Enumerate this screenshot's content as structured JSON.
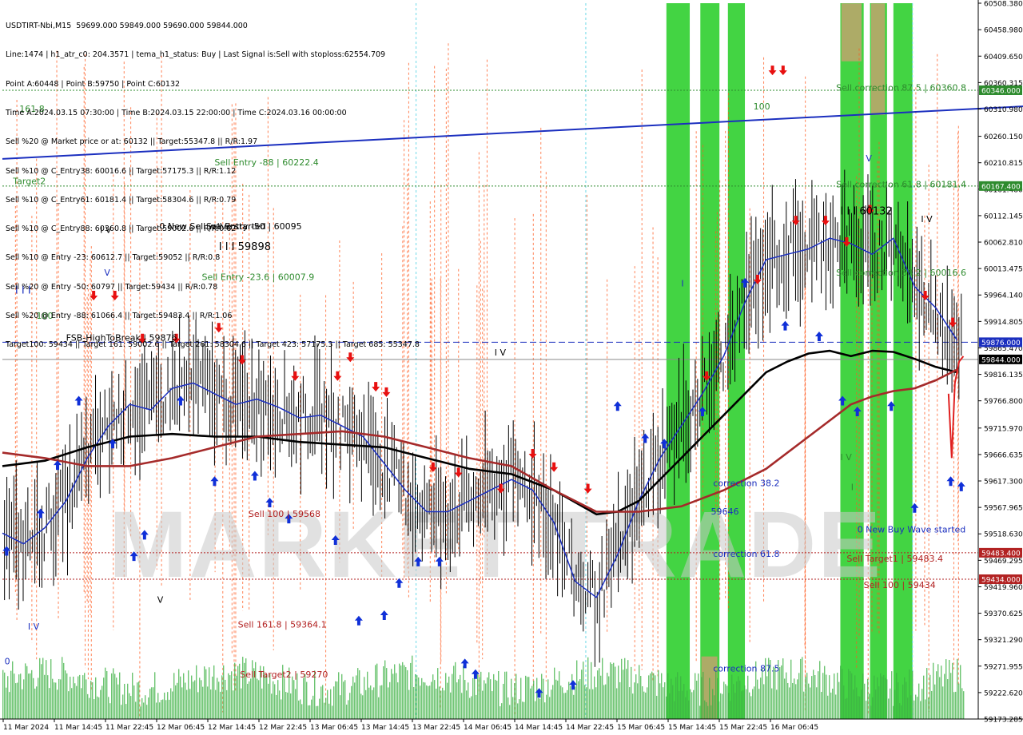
{
  "header": {
    "lines": [
      "USDTIRT-Nbi,M15  59699.000 59849.000 59690.000 59844.000",
      "Line:1474 | h1_atr_c0: 204.3571 | tema_h1_status: Buy | Last Signal is:Sell with stoploss:62554.709",
      "Point A:60448 | Point B:59750 | Point C:60132",
      "Time A:2024.03.15 07:30:00 | Time B:2024.03.15 22:00:00 | Time C:2024.03.16 00:00:00",
      "Sell %20 @ Market price or at: 60132 || Target:55347.8 || R/R:1.97",
      "Sell %10 @ C_Entry38: 60016.6 || Target:57175.3 || R/R:1.12",
      "Sell %10 @ C_Entry61: 60181.4 || Target:58304.6 || R/R:0.79",
      "Sell %10 @ C_Entry88: 60360.8 || Target:59002.6 || R/R:0.62",
      "Sell %10 @ Entry -23: 60612.7 || Target:59052 || R/R:0.8",
      "Sell %20 @ Entry -50: 60797 || Target:59434 || R/R:0.78",
      "Sell %20 @ Entry -88: 61066.4 || Target:59483.4 || R/R:1.06",
      "Target100: 59434 || Target 161: 59002.6 || Target 261: 58304.6 || Target 423: 57175.3 || Target 685: 55347.8"
    ]
  },
  "watermark": "MARKET TRADE",
  "chart_data": {
    "type": "candlestick",
    "symbol": "USDTIRT-Nbi",
    "timeframe": "M15",
    "ylim": [
      59173.285,
      60508.38
    ],
    "y_ticks": [
      "60508.380",
      "60458.980",
      "60409.650",
      "60360.315",
      "60310.980",
      "60260.150",
      "60210.815",
      "60161.480",
      "60112.145",
      "60062.810",
      "60013.475",
      "59964.140",
      "59914.805",
      "59865.470",
      "59816.135",
      "59766.800",
      "59715.970",
      "59666.635",
      "59617.300",
      "59567.965",
      "59518.630",
      "59469.295",
      "59419.960",
      "59370.625",
      "59321.290",
      "59271.955",
      "59222.620",
      "59173.285"
    ],
    "x_labels": [
      "11 Mar 2024",
      "11 Mar 14:45",
      "11 Mar 22:45",
      "12 Mar 06:45",
      "12 Mar 14:45",
      "12 Mar 22:45",
      "13 Mar 06:45",
      "13 Mar 14:45",
      "13 Mar 22:45",
      "14 Mar 06:45",
      "14 Mar 14:45",
      "14 Mar 22:45",
      "15 Mar 06:45",
      "15 Mar 14:45",
      "15 Mar 22:45",
      "16 Mar 06:45"
    ],
    "price_tags": [
      {
        "value": 60346.0,
        "label": "60346.000",
        "color": "#2e8b2e"
      },
      {
        "value": 60167.4,
        "label": "60167.400",
        "color": "#2e8b2e"
      },
      {
        "value": 59876.0,
        "label": "59876.000",
        "color": "#1b2fbf"
      },
      {
        "value": 59844.0,
        "label": "59844.000",
        "color": "#000000"
      },
      {
        "value": 59483.4,
        "label": "59483.400",
        "color": "#b22222"
      },
      {
        "value": 59434.0,
        "label": "59434.000",
        "color": "#b22222"
      }
    ],
    "levels": [
      {
        "value": 60346.0,
        "color": "#2e8b2e",
        "style": "dotted"
      },
      {
        "value": 60167.4,
        "color": "#2e8b2e",
        "style": "dotted"
      },
      {
        "value": 59876.0,
        "color": "#1b2fbf",
        "style": "dashed"
      },
      {
        "value": 59844.0,
        "color": "#8a8a8a",
        "style": "solid"
      },
      {
        "value": 59483.4,
        "color": "#b22222",
        "style": "dotted"
      },
      {
        "value": 59434.0,
        "color": "#b22222",
        "style": "dotted"
      }
    ],
    "annotations": [
      {
        "text": "161.8",
        "color": "#2e8b2e",
        "at": [
          0.8,
          60306
        ]
      },
      {
        "text": "Target2",
        "color": "#2e8b2e",
        "at": [
          0.5,
          60171
        ]
      },
      {
        "text": "100",
        "color": "#2e8b2e",
        "at": [
          1.6,
          59920
        ]
      },
      {
        "text": "Sell Entry -88 | 60222.4",
        "color": "#2e8b2e",
        "at": [
          10,
          60206
        ]
      },
      {
        "text": "0 New Sell wave started",
        "color": "#000000",
        "at": [
          7.4,
          60087
        ]
      },
      {
        "text": "Sell Entry -50 | 60095",
        "color": "#000000",
        "at": [
          9.6,
          60087
        ]
      },
      {
        "text": "I I I 59898",
        "color": "#000000",
        "at": [
          10.2,
          60048
        ]
      },
      {
        "text": "Sell Entry -23.6 | 60007.9",
        "color": "#2e8b2e",
        "at": [
          9.4,
          59992
        ]
      },
      {
        "text": "I V",
        "color": "#000000",
        "at": [
          4.6,
          60080
        ]
      },
      {
        "text": "V",
        "color": "#1b2fbf",
        "at": [
          4.8,
          60000
        ]
      },
      {
        "text": "I I I",
        "color": "#1b2fbf",
        "at": [
          0.6,
          59967
        ]
      },
      {
        "text": "FSB-HighToBreak | 59876",
        "color": "#000000",
        "at": [
          3,
          59879
        ]
      },
      {
        "text": "I V",
        "color": "#000000",
        "at": [
          23.2,
          59851
        ]
      },
      {
        "text": "Sell 100 | 59568",
        "color": "#b22222",
        "at": [
          11.6,
          59550
        ]
      },
      {
        "text": "Sell 161.8 | 59364.1",
        "color": "#b22222",
        "at": [
          11.1,
          59344
        ]
      },
      {
        "text": "Sell Target2 | 59270",
        "color": "#b22222",
        "at": [
          11.2,
          59251
        ]
      },
      {
        "text": "V",
        "color": "#000000",
        "at": [
          7.3,
          59390
        ]
      },
      {
        "text": "I V",
        "color": "#1b2fbf",
        "at": [
          1.2,
          59340
        ]
      },
      {
        "text": "0",
        "color": "#1b2fbf",
        "at": [
          0.1,
          59275
        ]
      },
      {
        "text": "I",
        "color": "#1b2fbf",
        "at": [
          32,
          59980
        ]
      },
      {
        "text": "100",
        "color": "#2e8b2e",
        "at": [
          35.4,
          60310
        ]
      },
      {
        "text": "Sell correction 87.5 | 60360.8",
        "color": "#2e8b2e",
        "at": [
          39.3,
          60345
        ]
      },
      {
        "text": "I I I 60132",
        "color": "#000000",
        "at": [
          39.5,
          60114
        ]
      },
      {
        "text": "V",
        "color": "#1b2fbf",
        "at": [
          40.7,
          60213
        ]
      },
      {
        "text": "Sell correction 61.8 | 60181.4",
        "color": "#2e8b2e",
        "at": [
          39.3,
          60165
        ]
      },
      {
        "text": "I V",
        "color": "#000000",
        "at": [
          43.3,
          60100
        ]
      },
      {
        "text": "Sell correction 38.2 | 60016.6",
        "color": "#2e8b2e",
        "at": [
          39.3,
          60000
        ]
      },
      {
        "text": "correction 38.2",
        "color": "#1b2fbf",
        "at": [
          33.5,
          59608
        ]
      },
      {
        "text": "59646",
        "color": "#1b2fbf",
        "at": [
          33.4,
          59555
        ]
      },
      {
        "text": "correction 61.8",
        "color": "#1b2fbf",
        "at": [
          33.5,
          59476
        ]
      },
      {
        "text": "correction 87.5",
        "color": "#1b2fbf",
        "at": [
          33.5,
          59262
        ]
      },
      {
        "text": "I V",
        "color": "#2e8b2e",
        "at": [
          39.5,
          59656
        ]
      },
      {
        "text": "I",
        "color": "#2e8b2e",
        "at": [
          40,
          59600
        ]
      },
      {
        "text": "0 New Buy Wave started",
        "color": "#1b2fbf",
        "at": [
          40.3,
          59521
        ]
      },
      {
        "text": "Sell Target1 | 59483.4",
        "color": "#b22222",
        "at": [
          39.8,
          59467
        ]
      },
      {
        "text": "Sell 100 | 59434",
        "color": "#b22222",
        "at": [
          40.6,
          59418
        ]
      }
    ],
    "trendline": {
      "color": "#1b2fbf",
      "from": [
        0,
        60218
      ],
      "to": [
        55,
        60330
      ]
    },
    "green_zones": [
      [
        31.3,
        32.4
      ],
      [
        32.9,
        33.8
      ],
      [
        34.2,
        35.0
      ],
      [
        39.5,
        40.6
      ],
      [
        40.9,
        41.7
      ],
      [
        42.0,
        42.9
      ]
    ],
    "series": [
      {
        "name": "",
        "color": "#1b2fbf",
        "style": "line",
        "x": [
          0,
          1,
          2,
          3,
          4,
          5,
          6,
          7,
          8,
          9,
          10,
          11,
          12,
          13,
          14,
          15,
          16,
          17,
          18,
          19,
          20,
          21,
          22,
          23,
          24,
          25,
          26,
          27,
          28,
          29,
          30,
          31,
          32,
          33,
          34,
          35,
          36,
          37,
          38,
          39,
          40,
          41,
          42,
          43,
          44,
          45
        ],
        "values": [
          59520,
          59500,
          59530,
          59580,
          59660,
          59720,
          59760,
          59750,
          59790,
          59800,
          59780,
          59760,
          59770,
          59755,
          59735,
          59740,
          59720,
          59700,
          59650,
          59600,
          59560,
          59560,
          59580,
          59600,
          59620,
          59600,
          59540,
          59430,
          59400,
          59480,
          59580,
          59660,
          59720,
          59780,
          59850,
          59950,
          60030,
          60040,
          60050,
          60070,
          60060,
          60040,
          60070,
          59980,
          59940,
          59880
        ]
      },
      {
        "name": "",
        "color": "#000000",
        "style": "line",
        "x": [
          0,
          2,
          4,
          6,
          8,
          10,
          12,
          14,
          16,
          18,
          20,
          22,
          24,
          26,
          28,
          29,
          30,
          31,
          32,
          33,
          34,
          35,
          36,
          37,
          38,
          39,
          40,
          41,
          42,
          43,
          44,
          45
        ],
        "values": [
          59645,
          59655,
          59680,
          59700,
          59705,
          59700,
          59700,
          59690,
          59685,
          59680,
          59660,
          59640,
          59630,
          59600,
          59555,
          59560,
          59580,
          59620,
          59660,
          59700,
          59740,
          59780,
          59820,
          59840,
          59855,
          59860,
          59850,
          59860,
          59858,
          59845,
          59830,
          59820
        ]
      },
      {
        "name": "",
        "color": "#a52a2a",
        "style": "line",
        "x": [
          0,
          2,
          4,
          6,
          8,
          10,
          12,
          14,
          16,
          18,
          20,
          22,
          24,
          26,
          28,
          30,
          32,
          34,
          36,
          38,
          39,
          40,
          41,
          42,
          43,
          44,
          45
        ],
        "values": [
          59670,
          59660,
          59645,
          59645,
          59660,
          59680,
          59700,
          59705,
          59710,
          59700,
          59680,
          59660,
          59645,
          59600,
          59560,
          59560,
          59570,
          59600,
          59640,
          59700,
          59730,
          59760,
          59775,
          59785,
          59790,
          59805,
          59825
        ]
      }
    ]
  }
}
